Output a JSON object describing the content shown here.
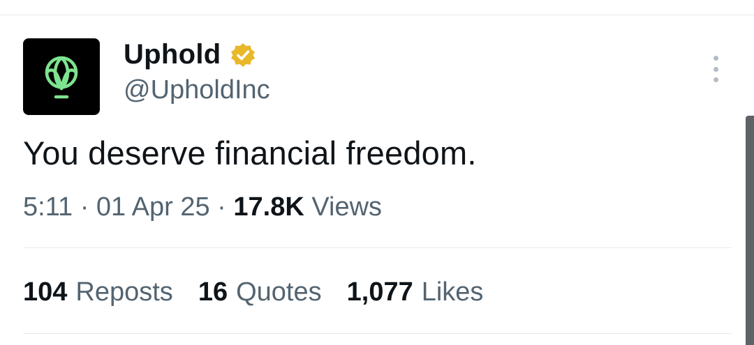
{
  "account": {
    "display_name": "Uphold",
    "handle": "@UpholdInc",
    "logo_icon": "uphold-logo-icon",
    "logo_color": "#7ee38f",
    "verified_color": "#e8b829"
  },
  "tweet": {
    "text": "You deserve financial freedom.",
    "time": "5:11",
    "date": "01 Apr 25",
    "separator": "·",
    "views_count": "17.8K",
    "views_label": "Views"
  },
  "stats": {
    "reposts_count": "104",
    "reposts_label": "Reposts",
    "quotes_count": "16",
    "quotes_label": "Quotes",
    "likes_count": "1,077",
    "likes_label": "Likes"
  }
}
